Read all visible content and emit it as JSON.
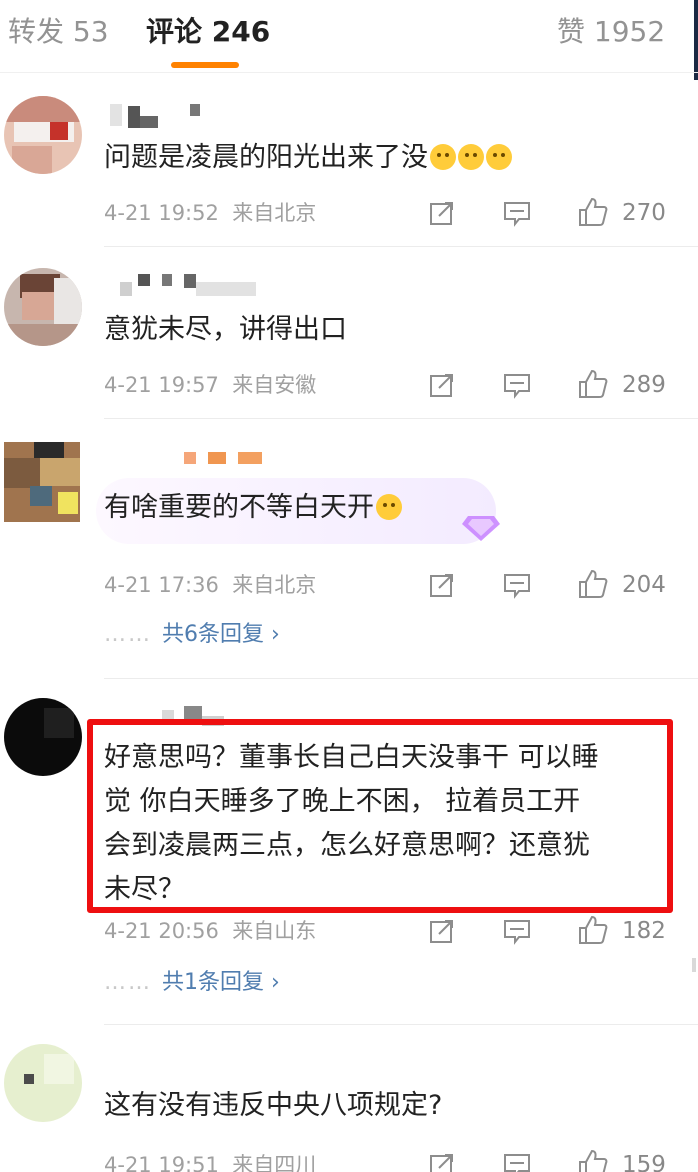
{
  "tabs": {
    "repost": "转发 53",
    "comments": "评论 246",
    "likes": "赞 1952"
  },
  "comments": [
    {
      "text": "问题是凌晨的阳光出来了没",
      "time": "4-21 19:52",
      "location": "来自北京",
      "likes": "270"
    },
    {
      "text": "意犹未尽，讲得出口",
      "time": "4-21 19:57",
      "location": "来自安徽",
      "likes": "289"
    },
    {
      "text": "有啥重要的不等白天开",
      "time": "4-21 17:36",
      "location": "来自北京",
      "likes": "204",
      "reply_prefix": "……",
      "replies": "共6条回复 ›"
    },
    {
      "text_lines": [
        "好意思吗？董事长自己白天没事干 可以睡",
        "觉  你白天睡多了晚上不困， 拉着员工开",
        "会到凌晨两三点，怎么好意思啊？还意犹",
        "未尽？"
      ],
      "time": "4-21 20:56",
      "location": "来自山东",
      "likes": "182",
      "reply_prefix": "……",
      "replies": "共1条回复 ›"
    },
    {
      "text": "这有没有违反中央八项规定?",
      "time": "4-21 19:51",
      "location": "来自四川",
      "likes": "159"
    }
  ],
  "icons": [
    "repost-icon",
    "comment-icon",
    "like-icon",
    "emoji-icon",
    "badge-icon"
  ],
  "colors": {
    "accent": "#ff8200",
    "link": "#507daf",
    "highlight": "#ee0f10",
    "meta": "#a0a0a0"
  }
}
